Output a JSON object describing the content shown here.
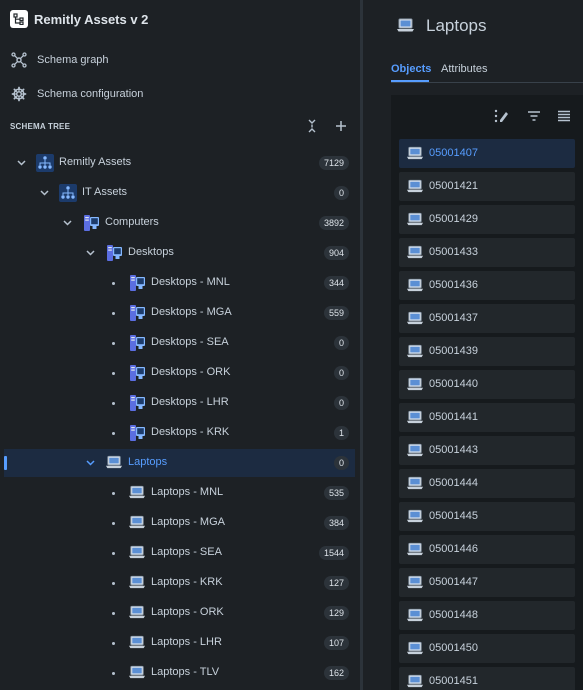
{
  "app": {
    "title": "Remitly Assets v 2"
  },
  "nav": [
    {
      "label": "Schema graph",
      "icon": "graph-icon"
    },
    {
      "label": "Schema configuration",
      "icon": "gear-icon"
    }
  ],
  "schema_tree": {
    "title": "SCHEMA TREE",
    "rows": [
      {
        "label": "Remitly Assets",
        "count": "7129",
        "icon": "hierarchy-icon",
        "expanded": true
      },
      {
        "label": "IT Assets",
        "count": "0",
        "icon": "hierarchy-icon",
        "expanded": true
      },
      {
        "label": "Computers",
        "count": "3892",
        "icon": "computer-icon",
        "expanded": true
      },
      {
        "label": "Desktops",
        "count": "904",
        "icon": "computer-icon",
        "expanded": true
      },
      {
        "label": "Desktops - MNL",
        "count": "344",
        "icon": "computer-icon"
      },
      {
        "label": "Desktops - MGA",
        "count": "559",
        "icon": "computer-icon"
      },
      {
        "label": "Desktops - SEA",
        "count": "0",
        "icon": "computer-icon"
      },
      {
        "label": "Desktops - ORK",
        "count": "0",
        "icon": "computer-icon"
      },
      {
        "label": "Desktops - LHR",
        "count": "0",
        "icon": "computer-icon"
      },
      {
        "label": "Desktops - KRK",
        "count": "1",
        "icon": "computer-icon"
      },
      {
        "label": "Laptops",
        "count": "0",
        "icon": "laptop-icon",
        "expanded": true,
        "selected": true
      },
      {
        "label": "Laptops - MNL",
        "count": "535",
        "icon": "laptop-icon"
      },
      {
        "label": "Laptops - MGA",
        "count": "384",
        "icon": "laptop-icon"
      },
      {
        "label": "Laptops - SEA",
        "count": "1544",
        "icon": "laptop-icon"
      },
      {
        "label": "Laptops - KRK",
        "count": "127",
        "icon": "laptop-icon"
      },
      {
        "label": "Laptops - ORK",
        "count": "129",
        "icon": "laptop-icon"
      },
      {
        "label": "Laptops - LHR",
        "count": "107",
        "icon": "laptop-icon"
      },
      {
        "label": "Laptops - TLV",
        "count": "162",
        "icon": "laptop-icon"
      }
    ]
  },
  "main": {
    "title": "Laptops",
    "tabs": [
      {
        "label": "Objects",
        "active": true
      },
      {
        "label": "Attributes",
        "active": false
      }
    ],
    "objects": [
      {
        "label": "05001407",
        "selected": true
      },
      {
        "label": "05001421"
      },
      {
        "label": "05001429"
      },
      {
        "label": "05001433"
      },
      {
        "label": "05001436"
      },
      {
        "label": "05001437"
      },
      {
        "label": "05001439"
      },
      {
        "label": "05001440"
      },
      {
        "label": "05001441"
      },
      {
        "label": "05001443"
      },
      {
        "label": "05001444"
      },
      {
        "label": "05001445"
      },
      {
        "label": "05001446"
      },
      {
        "label": "05001447"
      },
      {
        "label": "05001448"
      },
      {
        "label": "05001450"
      },
      {
        "label": "05001451"
      }
    ]
  },
  "colors": {
    "accent": "#579dff",
    "background": "#1d2125",
    "panel": "#161a1d",
    "row": "#22272b",
    "selected": "#1c2b41"
  }
}
